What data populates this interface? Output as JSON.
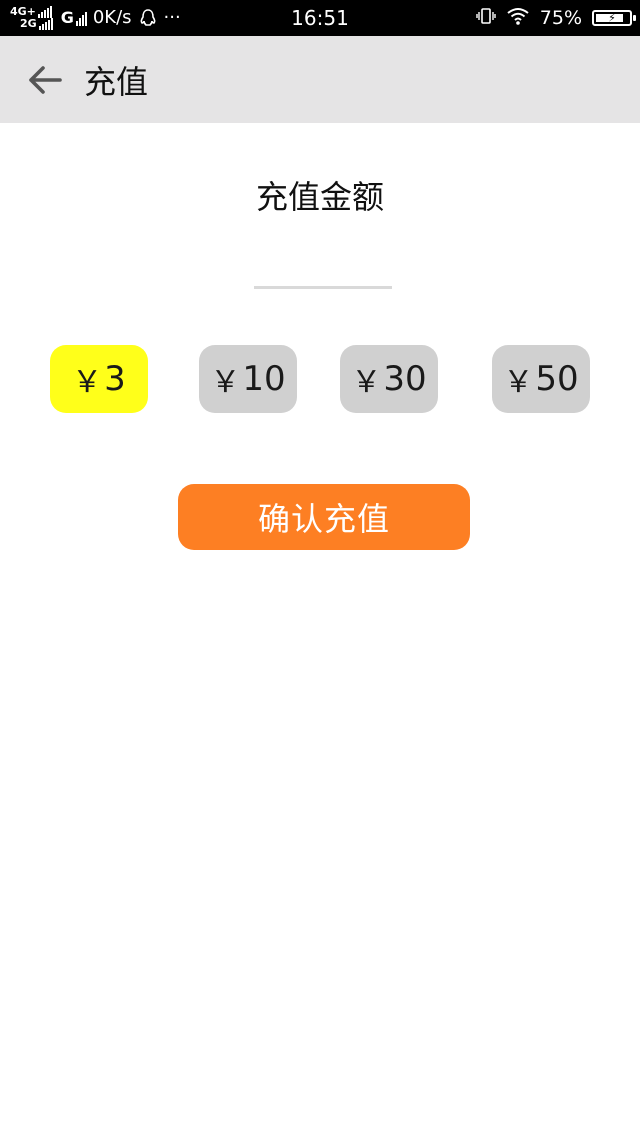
{
  "status_bar": {
    "network_top": "4G+",
    "network_bottom": "2G",
    "carrier_g": "G",
    "speed": "0K/s",
    "more": "···",
    "time": "16:51",
    "battery": "75%"
  },
  "app_bar": {
    "title": "充值"
  },
  "recharge": {
    "label": "充值金额",
    "input_value": "",
    "currency_symbol": "￥",
    "options": [
      {
        "amount": "3",
        "selected": true
      },
      {
        "amount": "10",
        "selected": false
      },
      {
        "amount": "30",
        "selected": false
      },
      {
        "amount": "50",
        "selected": false
      }
    ],
    "confirm_label": "确认充值"
  },
  "colors": {
    "selected_option": "#ffff1a",
    "unselected_option": "#d0d0d0",
    "confirm_button": "#fd7f23",
    "app_bar": "#e5e4e5"
  }
}
